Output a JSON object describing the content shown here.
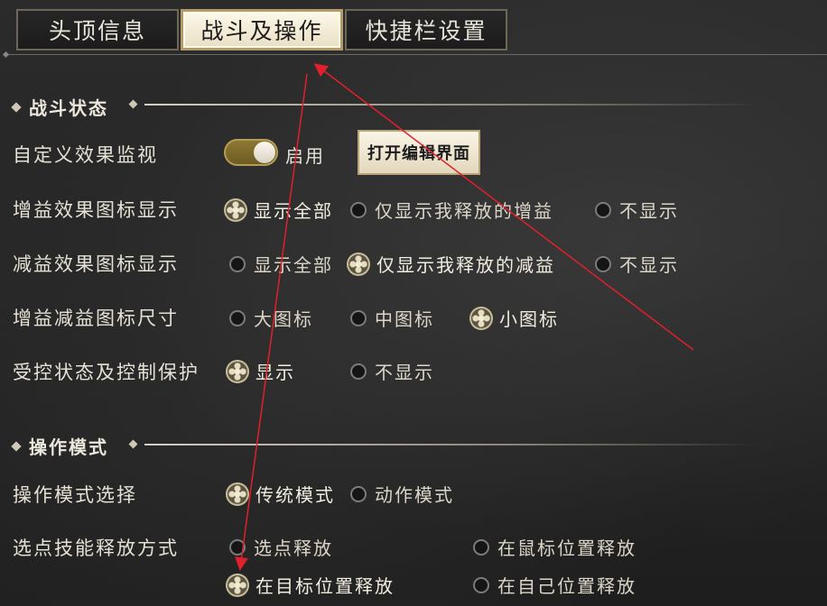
{
  "tabs": [
    {
      "label": "头顶信息",
      "active": false
    },
    {
      "label": "战斗及操作",
      "active": true
    },
    {
      "label": "快捷栏设置",
      "active": false
    }
  ],
  "combat_state": {
    "title": "战斗状态",
    "effect_monitor": {
      "label": "自定义效果监视",
      "toggle_on": true,
      "toggle_label": "启用",
      "edit_button": "打开编辑界面"
    },
    "buff_icon_display": {
      "label": "增益效果图标显示",
      "options": [
        "显示全部",
        "仅显示我释放的增益",
        "不显示"
      ],
      "selected": "显示全部"
    },
    "debuff_icon_display": {
      "label": "减益效果图标显示",
      "options": [
        "显示全部",
        "仅显示我释放的减益",
        "不显示"
      ],
      "selected": "仅显示我释放的减益"
    },
    "icon_size": {
      "label": "增益减益图标尺寸",
      "options": [
        "大图标",
        "中图标",
        "小图标"
      ],
      "selected": "小图标"
    },
    "control_protection": {
      "label": "受控状态及控制保护",
      "options": [
        "显示",
        "不显示"
      ],
      "selected": "显示"
    }
  },
  "operation_mode": {
    "title": "操作模式",
    "mode_select": {
      "label": "操作模式选择",
      "options": [
        "传统模式",
        "动作模式"
      ],
      "selected": "传统模式"
    },
    "target_skill": {
      "label": "选点技能释放方式",
      "options": [
        "选点释放",
        "在鼠标位置释放",
        "在目标位置释放",
        "在自己位置释放"
      ],
      "selected": "在目标位置释放"
    }
  },
  "colors": {
    "annotation_arrow": "#e0202a",
    "accent_gold": "#8f7a35"
  }
}
